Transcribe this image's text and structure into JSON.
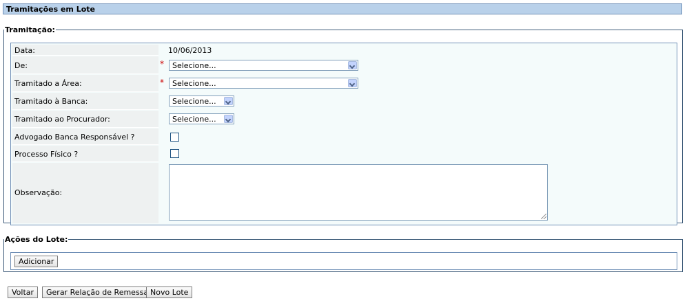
{
  "header": {
    "title": "Tramitações em Lote"
  },
  "tramitacao": {
    "legend": "Tramitação:",
    "fields": {
      "data": {
        "label": "Data:",
        "value": "10/06/2013"
      },
      "de": {
        "label": "De:",
        "required": "*",
        "value": "Selecione..."
      },
      "area": {
        "label": "Tramitado a Área:",
        "required": "*",
        "value": "Selecione..."
      },
      "banca": {
        "label": "Tramitado à Banca:",
        "value": "Selecione..."
      },
      "procurador": {
        "label": "Tramitado ao Procurador:",
        "value": "Selecione..."
      },
      "advogado": {
        "label": "Advogado Banca Responsável ?",
        "checked": false
      },
      "processo": {
        "label": "Processo Físico ?",
        "checked": false
      },
      "observacao": {
        "label": "Observação:",
        "value": ""
      }
    }
  },
  "acoes": {
    "legend": "Ações do Lote:",
    "add_label": "Adicionar"
  },
  "footer": {
    "voltar": "Voltar",
    "gerar": "Gerar Relação de Remessa",
    "novo": "Novo Lote"
  }
}
